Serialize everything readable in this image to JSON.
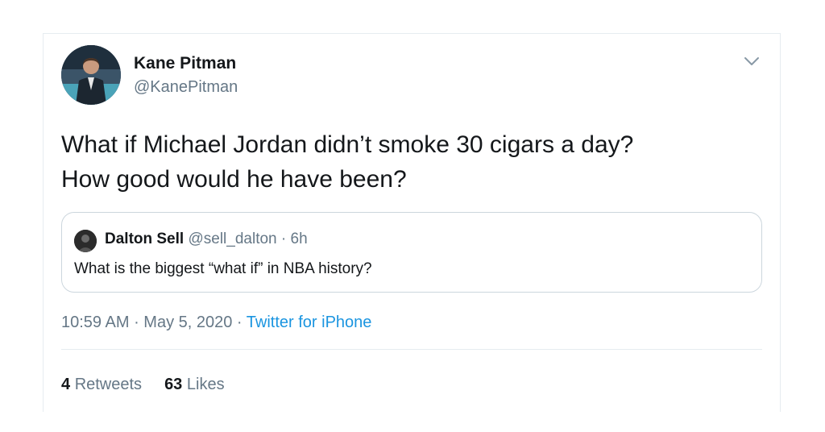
{
  "tweet": {
    "author": {
      "name": "Kane Pitman",
      "handle": "@KanePitman"
    },
    "menu_icon": "chevron-down-icon",
    "text_lines": [
      "What if Michael Jordan didn’t smoke 30 cigars a day?",
      "How good would he have been?"
    ],
    "quoted": {
      "name": "Dalton Sell",
      "handle": "@sell_dalton",
      "separator": " · ",
      "age": "6h",
      "text": "What is the biggest “what if” in NBA history?"
    },
    "time": "10:59 AM",
    "date": "May 5, 2020",
    "separator": " · ",
    "source": "Twitter for iPhone",
    "stats": {
      "retweets_count": "4",
      "retweets_label": "Retweets",
      "likes_count": "63",
      "likes_label": "Likes"
    }
  },
  "colors": {
    "primary_text": "#14171a",
    "secondary_text": "#657786",
    "link": "#1b95e0",
    "border": "#e6ecf0"
  }
}
